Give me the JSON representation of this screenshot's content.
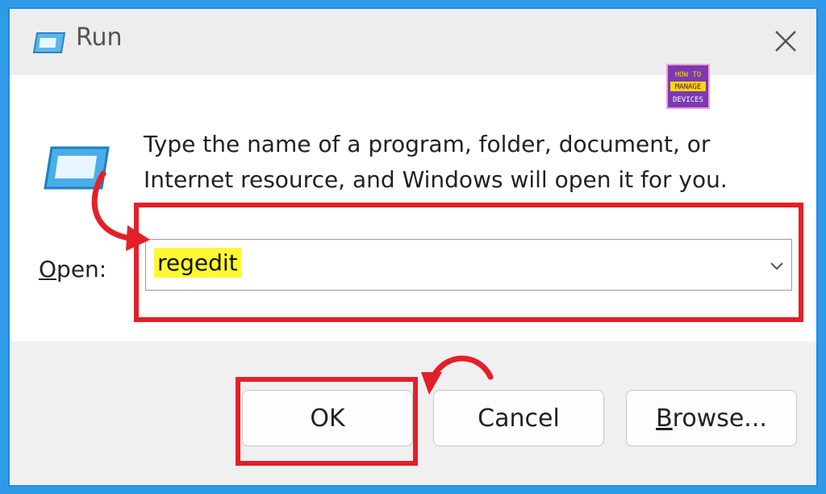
{
  "window": {
    "title": "Run",
    "description": "Type the name of a program, folder, document, or Internet resource, and Windows will open it for you.",
    "open_label_u": "O",
    "open_label_rest": "pen:",
    "input_value": "regedit"
  },
  "buttons": {
    "ok": "OK",
    "cancel": "Cancel",
    "browse_u": "B",
    "browse_rest": "rowse..."
  },
  "logo": {
    "line1": "HOW TO",
    "line2": "MANAGE",
    "line3": "DEVICES"
  },
  "colors": {
    "highlight_box": "#e3202a",
    "text_highlight": "#fff833",
    "frame": "#2f9be8"
  },
  "icons": [
    "run-icon",
    "close-icon",
    "chevron-down-icon",
    "curved-arrow-icon"
  ]
}
